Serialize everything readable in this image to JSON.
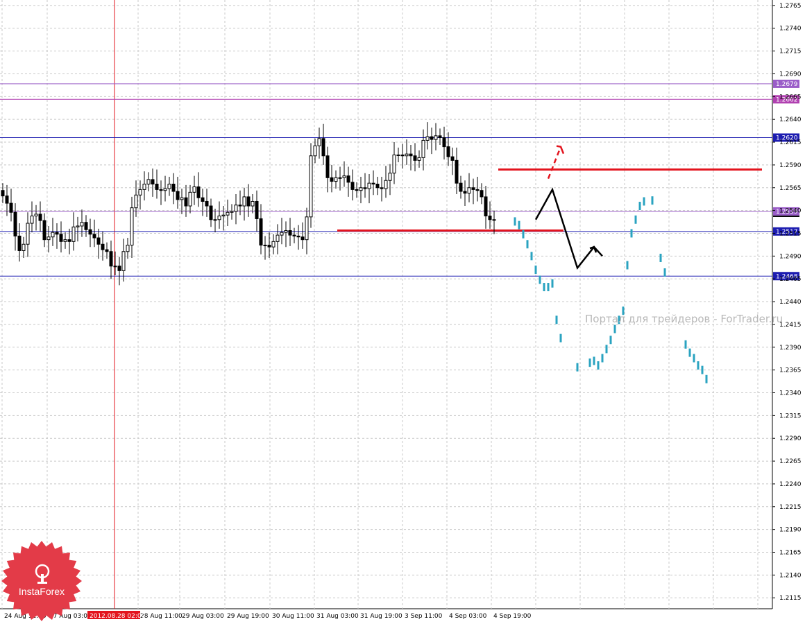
{
  "chart_data": {
    "type": "candlestick",
    "ylim": [
      1.2103,
      1.2771
    ],
    "y_ticks": [
      "1.2765",
      "1.2740",
      "1.2715",
      "1.2690",
      "1.2665",
      "1.2640",
      "1.2615",
      "1.2590",
      "1.2565",
      "1.2540",
      "1.2515",
      "1.2490",
      "1.2465",
      "1.2440",
      "1.2415",
      "1.2390",
      "1.2365",
      "1.2340",
      "1.2315",
      "1.2290",
      "1.2265",
      "1.2240",
      "1.2215",
      "1.2190",
      "1.2165",
      "1.2140",
      "1.2115"
    ],
    "x_ticks": [
      "24 Aug 11:00",
      "27 Aug 03:00",
      "28 Aug 11:00",
      "29 Aug 03:00",
      "29 Aug 19:00",
      "30 Aug 11:00",
      "31 Aug 03:00",
      "31 Aug 19:00",
      "3 Sep 11:00",
      "4 Sep 03:00",
      "4 Sep 19:00"
    ],
    "cursor_time": "2012.08.28 02:00",
    "current_price": "1.2539",
    "levels": [
      {
        "value": "1.2679",
        "color": "#9a5dc8"
      },
      {
        "value": "1.2662",
        "color": "#b040b0"
      },
      {
        "value": "1.2620",
        "color": "#1c1cb0"
      },
      {
        "value": "1.2539",
        "color": "#9a5dc8"
      },
      {
        "value": "1.2517",
        "color": "#1c1cb0"
      },
      {
        "value": "1.2468",
        "color": "#1c1cb0"
      }
    ],
    "resistance_line": 1.2585,
    "support_line": 1.2518,
    "candles_close": [
      1.2556,
      1.2548,
      1.2538,
      1.2512,
      1.2496,
      1.2503,
      1.2526,
      1.2534,
      1.2536,
      1.2529,
      1.2508,
      1.2511,
      1.2516,
      1.2514,
      1.2506,
      1.2508,
      1.2506,
      1.2522,
      1.2523,
      1.2527,
      1.2519,
      1.2514,
      1.251,
      1.2503,
      1.2497,
      1.2495,
      1.2479,
      1.2479,
      1.2474,
      1.2495,
      1.2502,
      1.2543,
      1.2557,
      1.2563,
      1.2569,
      1.2574,
      1.2569,
      1.2563,
      1.2562,
      1.2564,
      1.2569,
      1.2561,
      1.2552,
      1.2554,
      1.2545,
      1.256,
      1.2566,
      1.2554,
      1.255,
      1.2545,
      1.253,
      1.253,
      1.2534,
      1.2535,
      1.2538,
      1.2539,
      1.2546,
      1.2545,
      1.2555,
      1.2545,
      1.255,
      1.2531,
      1.2502,
      1.2502,
      1.25,
      1.2506,
      1.2513,
      1.2516,
      1.2518,
      1.2513,
      1.2512,
      1.2511,
      1.2508,
      1.2533,
      1.26,
      1.2611,
      1.2619,
      1.26,
      1.2576,
      1.2572,
      1.2576,
      1.2576,
      1.2578,
      1.2571,
      1.2563,
      1.2562,
      1.2565,
      1.2564,
      1.257,
      1.2569,
      1.2565,
      1.2564,
      1.2573,
      1.2581,
      1.2601,
      1.2601,
      1.26,
      1.2602,
      1.26,
      1.2595,
      1.2598,
      1.2617,
      1.2621,
      1.2618,
      1.2622,
      1.262,
      1.261,
      1.2599,
      1.2595,
      1.257,
      1.2561,
      1.2559,
      1.2565,
      1.2563,
      1.2562,
      1.2555,
      1.2534,
      1.253,
      1.253
    ],
    "forecast_bars": [
      {
        "t": 123,
        "y": 1.2528
      },
      {
        "t": 124,
        "y": 1.2524
      },
      {
        "t": 125,
        "y": 1.2514
      },
      {
        "t": 126,
        "y": 1.2503
      },
      {
        "t": 127,
        "y": 1.249
      },
      {
        "t": 128,
        "y": 1.2475
      },
      {
        "t": 129,
        "y": 1.2464
      },
      {
        "t": 130,
        "y": 1.2456
      },
      {
        "t": 131,
        "y": 1.2456
      },
      {
        "t": 132,
        "y": 1.246
      },
      {
        "t": 133,
        "y": 1.242
      },
      {
        "t": 134,
        "y": 1.24
      },
      {
        "t": 138,
        "y": 1.2368
      },
      {
        "t": 141,
        "y": 1.2373
      },
      {
        "t": 142,
        "y": 1.2375
      },
      {
        "t": 143,
        "y": 1.237
      },
      {
        "t": 144,
        "y": 1.2378
      },
      {
        "t": 145,
        "y": 1.2388
      },
      {
        "t": 146,
        "y": 1.2398
      },
      {
        "t": 147,
        "y": 1.241
      },
      {
        "t": 148,
        "y": 1.242
      },
      {
        "t": 149,
        "y": 1.243
      },
      {
        "t": 150,
        "y": 1.248
      },
      {
        "t": 151,
        "y": 1.2515
      },
      {
        "t": 152,
        "y": 1.253
      },
      {
        "t": 153,
        "y": 1.2545
      },
      {
        "t": 154,
        "y": 1.255
      },
      {
        "t": 156,
        "y": 1.2551
      },
      {
        "t": 158,
        "y": 1.2488
      },
      {
        "t": 159,
        "y": 1.2472
      },
      {
        "t": 164,
        "y": 1.2393
      },
      {
        "t": 165,
        "y": 1.2384
      },
      {
        "t": 166,
        "y": 1.2378
      },
      {
        "t": 167,
        "y": 1.237
      },
      {
        "t": 168,
        "y": 1.2365
      },
      {
        "t": 169,
        "y": 1.2355
      }
    ],
    "scenario_path": [
      [
        128,
        1.253
      ],
      [
        132,
        1.2563
      ],
      [
        138,
        1.2477
      ],
      [
        142,
        1.25
      ],
      [
        144,
        1.249
      ]
    ],
    "scenario_alt": [
      [
        131,
        1.2575
      ],
      [
        134,
        1.261
      ]
    ],
    "grid": true
  },
  "watermark": "Портал для трейдеров - ForTrader.ru",
  "logo": {
    "text": "InstaForex",
    "color": "#e33b48"
  }
}
